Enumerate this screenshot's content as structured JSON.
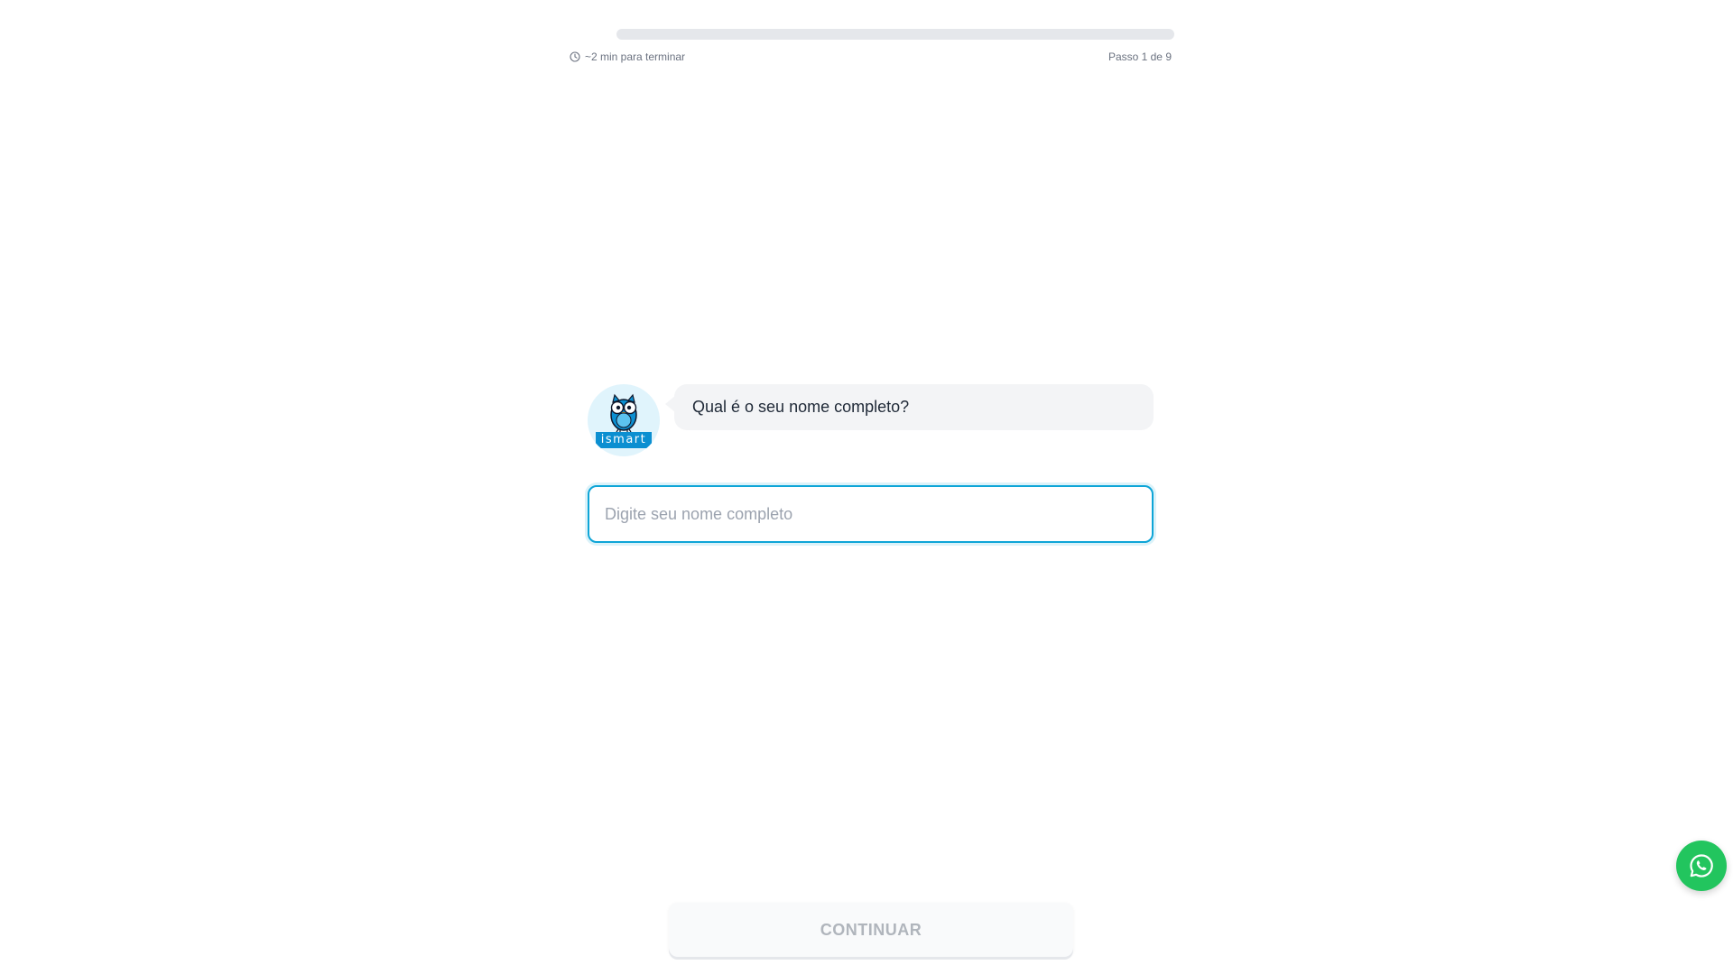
{
  "progress": {
    "fraction": 0.0,
    "time_left": "~2 min para terminar",
    "step_label": "Passo 1 de 9"
  },
  "chat": {
    "avatar_logo_text": "ismart",
    "question": "Qual é o seu nome completo?"
  },
  "form": {
    "name_placeholder": "Digite seu nome completo",
    "name_value": ""
  },
  "actions": {
    "continue_label": "CONTINUAR"
  },
  "icons": {
    "clock": "clock-icon",
    "whatsapp": "whatsapp-icon",
    "owl": "owl-mascot-icon"
  },
  "colors": {
    "accent": "#0ea5d7",
    "whatsapp": "#22c55e",
    "logo_blue": "#0b8fd1"
  }
}
